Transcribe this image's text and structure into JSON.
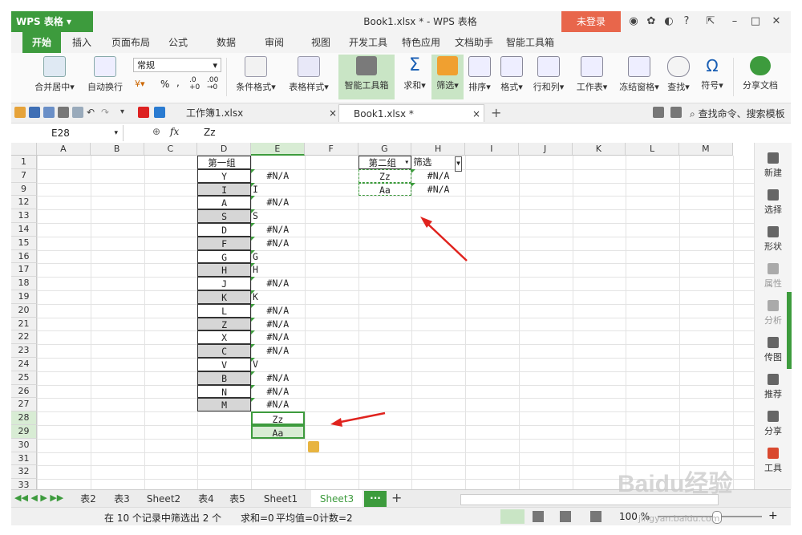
{
  "titlebar": {
    "app_name": "WPS 表格",
    "window_title": "Book1.xlsx * - WPS 表格",
    "login": "未登录",
    "help": "?"
  },
  "tabs": [
    "开始",
    "插入",
    "页面布局",
    "公式",
    "数据",
    "审阅",
    "视图",
    "开发工具",
    "特色应用",
    "文档助手",
    "智能工具箱"
  ],
  "ribbon": {
    "merge": "合并居中",
    "wrap": "自动换行",
    "number_format": "常规",
    "percent": "%",
    "comma": " ",
    "dec_inc": ".0\n+0",
    "dec_dec": ".00\n→0",
    "cond_format": "条件格式",
    "table_style": "表格样式",
    "smart_toolbox": "智能工具箱",
    "sum": "求和",
    "filter": "筛选",
    "sort": "排序",
    "format": "格式",
    "rowcol": "行和列",
    "worksheet": "工作表",
    "freeze": "冻结窗格",
    "find": "查找",
    "symbol": "符号",
    "share": "分享文档"
  },
  "doc_tabs": {
    "tab1": "工作簿1.xlsx",
    "tab2": "Book1.xlsx *",
    "search": "查找命令、搜索模板"
  },
  "formula_bar": {
    "cell_ref": "E28",
    "fx": "fx",
    "content": "Zz"
  },
  "columns": [
    "A",
    "B",
    "C",
    "D",
    "E",
    "F",
    "G",
    "H",
    "I",
    "J",
    "K",
    "L",
    "M"
  ],
  "rows": [
    "1",
    "7",
    "9",
    "12",
    "13",
    "14",
    "15",
    "16",
    "17",
    "18",
    "19",
    "20",
    "21",
    "22",
    "23",
    "24",
    "25",
    "26",
    "27",
    "28",
    "29",
    "30",
    "31",
    "32",
    "33"
  ],
  "cells": {
    "d_header": "第一组",
    "d": [
      "Y",
      "I",
      "A",
      "S",
      "D",
      "F",
      "G",
      "H",
      "J",
      "K",
      "L",
      "Z",
      "X",
      "C",
      "V",
      "B",
      "N",
      "M"
    ],
    "e": [
      "#N/A",
      "I",
      "#N/A",
      "S",
      "#N/A",
      "#N/A",
      "G",
      "H",
      "#N/A",
      "K",
      "#N/A",
      "#N/A",
      "#N/A",
      "#N/A",
      "V",
      "#N/A",
      "#N/A",
      "#N/A"
    ],
    "e28": "Zz",
    "e29": "Aa",
    "g_header": "第二组",
    "h_header": "筛选",
    "g": [
      "Zz",
      "Aa"
    ],
    "h": [
      "#N/A",
      "#N/A"
    ]
  },
  "right_panel": [
    "新建",
    "选择",
    "形状",
    "属性",
    "分析",
    "传图",
    "推荐",
    "分享",
    "工具"
  ],
  "sheet_tabs": [
    "表2",
    "表3",
    "Sheet2",
    "表4",
    "表5",
    "Sheet1",
    "Sheet3"
  ],
  "active_sheet": "Sheet3",
  "status": {
    "filter_info": "在 10 个记录中筛选出 2 个",
    "sum": "求和=0",
    "avg": "平均值=0",
    "count": "计数=2",
    "zoom": "100 %"
  },
  "watermark": {
    "brand": "Baidu经验",
    "url": "jingyan.baidu.com"
  },
  "colors": {
    "accent_green": "#3d9b3d",
    "login_red": "#e8664b",
    "arrow_red": "#e0231e"
  }
}
